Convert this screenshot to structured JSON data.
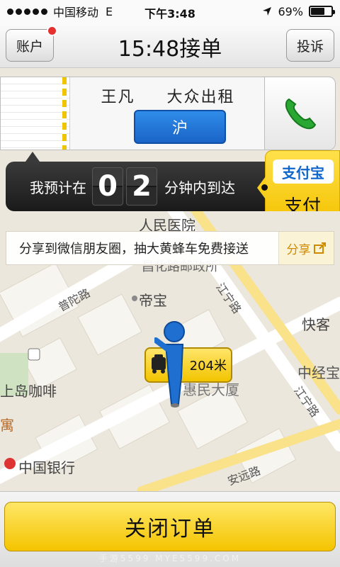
{
  "status_bar": {
    "carrier": "中国移动",
    "network": "E",
    "time": "下午3:48",
    "battery": "69%",
    "battery_level": 0.69
  },
  "header": {
    "account_label": "账户",
    "title": "15:48接单",
    "complain_label": "投诉"
  },
  "driver": {
    "name": "王凡",
    "company": "大众出租",
    "plate": "沪"
  },
  "eta": {
    "prefix": "我预计在",
    "digit1": "0",
    "digit2": "2",
    "suffix": "分钟内到达"
  },
  "alipay": {
    "logo_text": "支付宝",
    "pay_label": "支付"
  },
  "share": {
    "text": "分享到微信朋友圈，抽大黄蜂车免费接送",
    "button": "分享"
  },
  "map": {
    "labels": [
      "人民医院",
      "普陀路",
      "帝宝",
      "江宁路",
      "惠民大厦",
      "上岛咖啡",
      "中国银行",
      "快客",
      "中经宝",
      "江宁路",
      "安远路",
      "昌化路邮政所",
      "寓"
    ],
    "distance": "204米"
  },
  "bottom": {
    "close_order": "关闭订单",
    "watermark": "手游5599 MYE5599.COM"
  },
  "colors": {
    "accent_yellow": "#f4c400",
    "plate_blue": "#1a64c8",
    "call_green": "#2aa632"
  }
}
